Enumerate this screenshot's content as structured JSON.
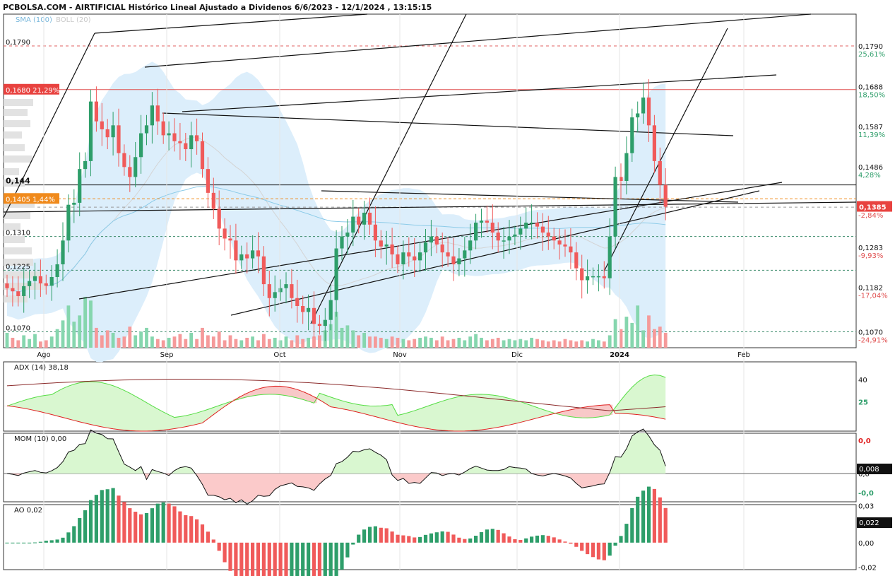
{
  "header": {
    "title": "PCBOLSA.COM - AIRTIFICIAL Histórico Lineal Ajustado a Dividenos 6/6/2023 - 12/1/2024 , 13:15:15",
    "indicator_sma": "SMA (100)",
    "indicator_boll": "BOLL (20)"
  },
  "colors": {
    "up": "#2e9e6a",
    "down": "#f05a5a",
    "boll_fill": "#dceefb",
    "sma": "#8ccbe8",
    "current_price_bg": "#e8423f",
    "level_orange": "#f08a1c"
  },
  "chart_data": [
    {
      "panel": "price",
      "type": "candlestick",
      "ylim": [
        0.103,
        0.187
      ],
      "x_labels": [
        "Ago",
        "Sep",
        "Oct",
        "Nov",
        "Dic",
        "2024",
        "Feb"
      ],
      "right_ticks": [
        {
          "value": "0,1790",
          "pct": "25,61%"
        },
        {
          "value": "0,1688",
          "pct": "18,50%"
        },
        {
          "value": "0,1587",
          "pct": "11,39%"
        },
        {
          "value": "0,1486",
          "pct": "4,28%"
        },
        {
          "value": "0,1384",
          "pct": "-2,84%"
        },
        {
          "value": "0,1283",
          "pct": "-9,93%"
        },
        {
          "value": "0,1182",
          "pct": "-17,04%"
        },
        {
          "value": "0,1070",
          "pct": "-24,91%"
        }
      ],
      "left_labels": [
        {
          "value": "0,1790"
        },
        {
          "value": "0,1680",
          "pct": "21,29%"
        },
        {
          "value": "0,144"
        },
        {
          "value": "0,1405",
          "pct": "1,44%"
        },
        {
          "value": "0,1310"
        },
        {
          "value": "0,1225"
        },
        {
          "value": "0,1070"
        }
      ],
      "current_price": "0,1385",
      "closes": [
        0.118,
        0.1172,
        0.116,
        0.1185,
        0.1198,
        0.121,
        0.1192,
        0.1186,
        0.1208,
        0.124,
        0.13,
        0.139,
        0.1395,
        0.148,
        0.15,
        0.165,
        0.16,
        0.158,
        0.156,
        0.159,
        0.152,
        0.1485,
        0.146,
        0.151,
        0.157,
        0.159,
        0.164,
        0.16,
        0.1565,
        0.157,
        0.155,
        0.1545,
        0.153,
        0.1565,
        0.155,
        0.148,
        0.142,
        0.138,
        0.133,
        0.1305,
        0.13,
        0.125,
        0.1265,
        0.1255,
        0.1275,
        0.126,
        0.119,
        0.1155,
        0.117,
        0.118,
        0.119,
        0.1155,
        0.1135,
        0.112,
        0.113,
        0.109,
        0.1085,
        0.11,
        0.115,
        0.128,
        0.131,
        0.132,
        0.136,
        0.134,
        0.137,
        0.134,
        0.13,
        0.1285,
        0.129,
        0.1265,
        0.124,
        0.127,
        0.126,
        0.125,
        0.127,
        0.1295,
        0.131,
        0.129,
        0.127,
        0.126,
        0.124,
        0.1255,
        0.1275,
        0.13,
        0.1345,
        0.135,
        0.1345,
        0.132,
        0.13,
        0.13,
        0.131,
        0.1315,
        0.133,
        0.1345,
        0.1345,
        0.1335,
        0.132,
        0.131,
        0.13,
        0.129,
        0.1285,
        0.127,
        0.123,
        0.12,
        0.121,
        0.121,
        0.121,
        0.1205,
        0.131,
        0.146,
        0.145,
        0.152,
        0.161,
        0.162,
        0.166,
        0.159,
        0.15,
        0.144,
        0.1385
      ],
      "volumes": [
        1.2,
        0.8,
        0.6,
        1.0,
        0.7,
        1.1,
        0.5,
        0.6,
        0.9,
        1.5,
        2.2,
        3.4,
        2.1,
        2.6,
        4.1,
        3.8,
        1.6,
        1.0,
        1.4,
        1.2,
        0.8,
        0.9,
        1.7,
        1.0,
        1.3,
        1.6,
        0.9,
        0.7,
        0.6,
        0.8,
        0.9,
        1.1,
        0.7,
        1.2,
        0.7,
        1.6,
        1.0,
        0.9,
        1.3,
        0.6,
        1.0,
        0.7,
        0.6,
        0.8,
        0.9,
        0.6,
        1.1,
        0.7,
        0.8,
        0.6,
        0.9,
        0.6,
        1.0,
        0.7,
        0.8,
        0.9,
        1.0,
        1.4,
        1.9,
        2.9,
        1.6,
        1.8,
        1.4,
        1.0,
        1.2,
        0.9,
        0.9,
        0.8,
        0.7,
        0.9,
        0.8,
        0.7,
        0.6,
        0.7,
        0.8,
        0.9,
        0.8,
        0.6,
        0.9,
        0.6,
        0.7,
        0.8,
        0.6,
        0.9,
        1.1,
        0.8,
        0.6,
        0.7,
        0.8,
        0.6,
        0.7,
        0.6,
        0.7,
        0.6,
        0.8,
        0.7,
        0.6,
        0.5,
        0.6,
        0.5,
        0.7,
        0.6,
        0.5,
        0.6,
        0.5,
        0.7,
        0.6,
        0.5,
        1.0,
        2.3,
        1.5,
        2.5,
        2.0,
        3.4,
        1.4,
        2.6,
        1.5,
        1.7,
        1.2
      ]
    },
    {
      "panel": "adx",
      "type": "line",
      "label": "ADX (14)",
      "value": "38,18",
      "right_ticks": [
        "40",
        "25"
      ],
      "ylim": [
        5,
        52
      ]
    },
    {
      "panel": "momentum",
      "type": "line",
      "label": "MOM (10)",
      "value": "0,00",
      "right_ticks": [
        "0,0",
        "0,0",
        "-0,0"
      ],
      "current_value": "0,008"
    },
    {
      "panel": "ao",
      "type": "bar",
      "label": "AO",
      "value": "0,02",
      "right_ticks": [
        "0,03",
        "0,00",
        "-0,02"
      ],
      "current_value": "0,022",
      "ylim": [
        -0.022,
        0.031
      ]
    }
  ]
}
